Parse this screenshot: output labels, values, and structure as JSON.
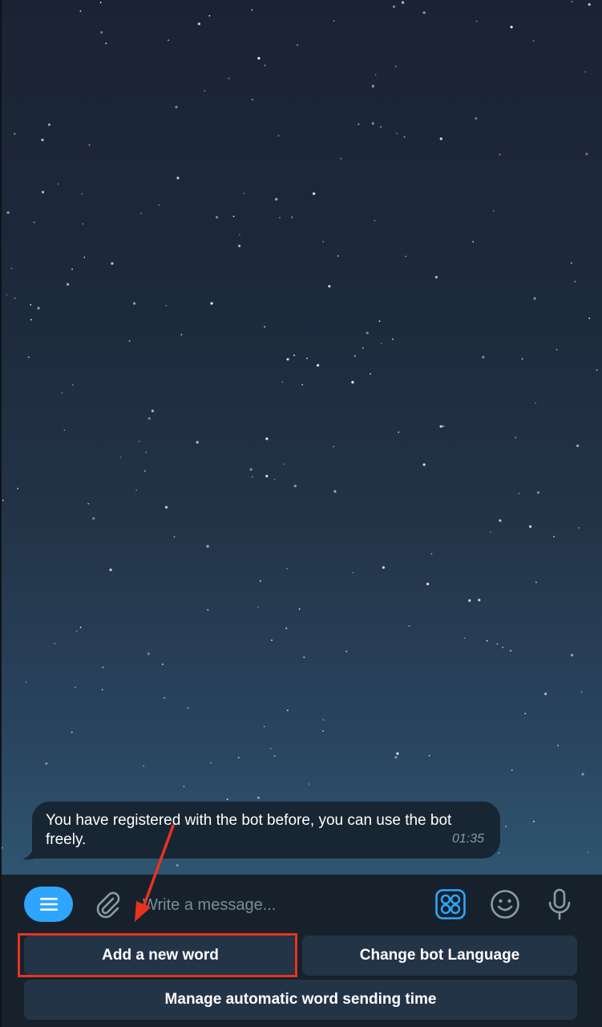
{
  "message": {
    "text": "You have registered with the bot before, you can use the bot freely.",
    "time": "01:35"
  },
  "composer": {
    "menu_icon": "hamburger-menu-icon",
    "attach_icon": "paperclip-icon",
    "placeholder": "Write a message...",
    "commands_icon": "bot-commands-icon",
    "emoji_icon": "smiley-icon",
    "mic_icon": "microphone-icon",
    "accent_color": "#2ea6ff"
  },
  "keyboard": {
    "add_word": "Add a new word",
    "change_language": "Change bot Language",
    "manage_time": "Manage automatic word sending time"
  },
  "annotation": {
    "highlight_color": "#e8331f"
  }
}
